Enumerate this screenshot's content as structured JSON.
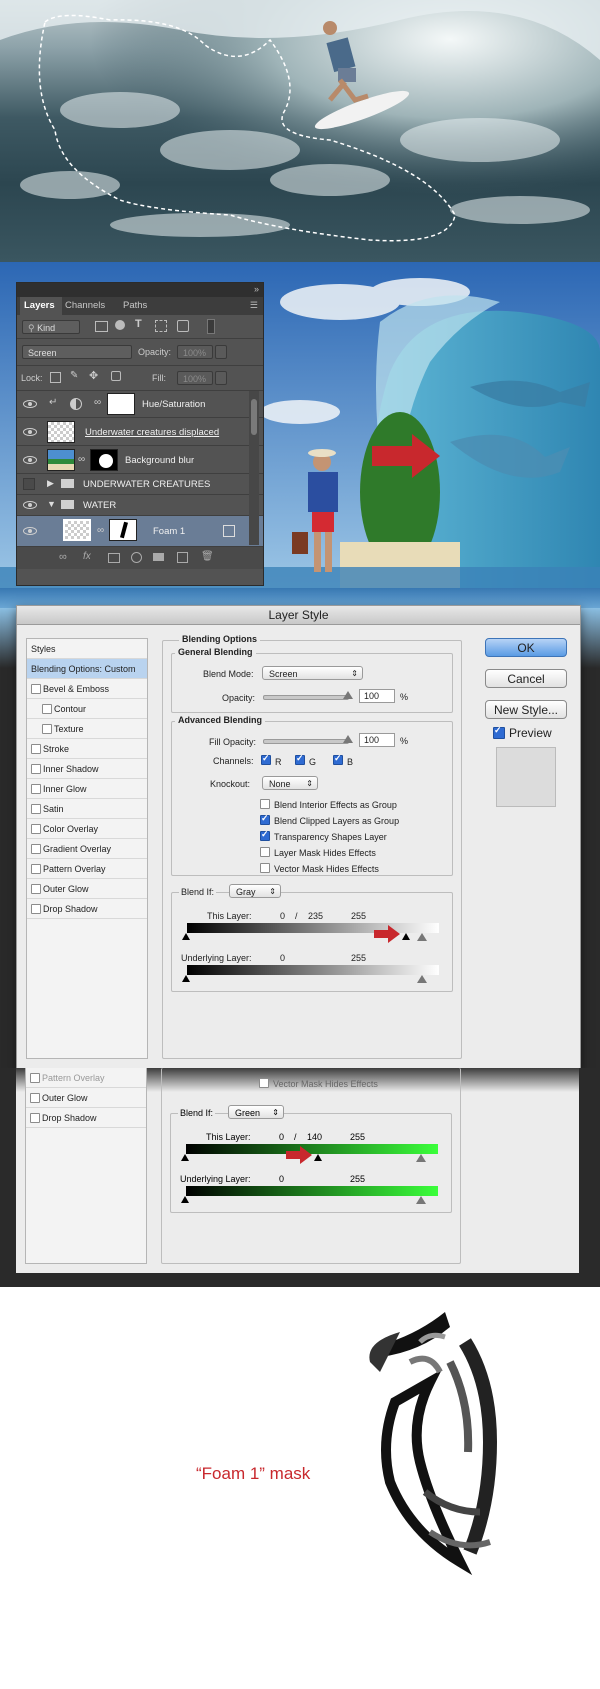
{
  "layers_panel": {
    "tabs": [
      "Layers",
      "Channels",
      "Paths"
    ],
    "filter_label": "Kind",
    "blend_mode": "Screen",
    "opacity_label": "Opacity:",
    "opacity_value": "100%",
    "lock_label": "Lock:",
    "fill_label": "Fill:",
    "fill_value": "100%",
    "layers": [
      {
        "name": "Hue/Saturation"
      },
      {
        "name": "Underwater creatures displaced"
      },
      {
        "name": "Background blur"
      },
      {
        "name": "UNDERWATER CREATURES"
      },
      {
        "name": "WATER"
      },
      {
        "name": "Foam 1"
      }
    ]
  },
  "dialog": {
    "title": "Layer Style",
    "styles_header": "Styles",
    "style_items": [
      "Blending Options: Custom",
      "Bevel & Emboss",
      "Contour",
      "Texture",
      "Stroke",
      "Inner Shadow",
      "Inner Glow",
      "Satin",
      "Color Overlay",
      "Gradient Overlay",
      "Pattern Overlay",
      "Outer Glow",
      "Drop Shadow"
    ],
    "blending_options_label": "Blending Options",
    "general_blending_label": "General Blending",
    "blend_mode_label": "Blend Mode:",
    "blend_mode_value": "Screen",
    "opacity_label": "Opacity:",
    "opacity_value": "100",
    "percent": "%",
    "advanced_blending_label": "Advanced Blending",
    "fill_opacity_label": "Fill Opacity:",
    "fill_opacity_value": "100",
    "channels_label": "Channels:",
    "channel_r": "R",
    "channel_g": "G",
    "channel_b": "B",
    "knockout_label": "Knockout:",
    "knockout_value": "None",
    "options": [
      {
        "label": "Blend Interior Effects as Group",
        "checked": false
      },
      {
        "label": "Blend Clipped Layers as Group",
        "checked": true
      },
      {
        "label": "Transparency Shapes Layer",
        "checked": true
      },
      {
        "label": "Layer Mask Hides Effects",
        "checked": false
      },
      {
        "label": "Vector Mask Hides Effects",
        "checked": false
      }
    ],
    "blend_if_label": "Blend If:",
    "blend_if_value": "Gray",
    "this_layer_label": "This Layer:",
    "this_layer_low": "0",
    "this_layer_sep": "/",
    "this_layer_mid": "235",
    "this_layer_high": "255",
    "underlying_label": "Underlying Layer:",
    "underlying_low": "0",
    "underlying_high": "255",
    "ok_label": "OK",
    "cancel_label": "Cancel",
    "new_style_label": "New Style...",
    "preview_label": "Preview"
  },
  "green_crop": {
    "style_items": [
      "Pattern Overlay",
      "Outer Glow",
      "Drop Shadow"
    ],
    "vector_mask_label": "Vector Mask Hides Effects",
    "blend_if_label": "Blend If:",
    "blend_if_value": "Green",
    "this_layer_label": "This Layer:",
    "this_layer_low": "0",
    "this_layer_sep": "/",
    "this_layer_mid": "140",
    "this_layer_high": "255",
    "underlying_label": "Underlying Layer:",
    "underlying_low": "0",
    "underlying_high": "255"
  },
  "mask_caption": "“Foam 1” mask",
  "colors": {
    "accent_red": "#c8282d",
    "green_bright": "#3bff3b",
    "selection_blue": "#b9d3ef"
  }
}
